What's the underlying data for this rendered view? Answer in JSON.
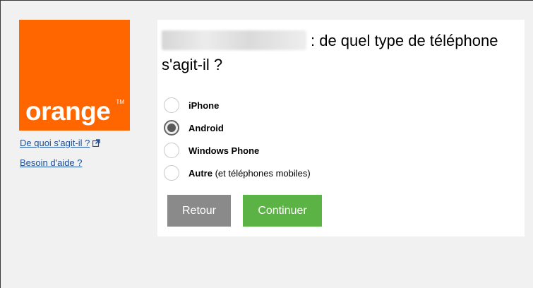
{
  "logo": {
    "text": "orange",
    "trademark": "TM"
  },
  "sidebar": {
    "what_is_it_label": "De quoi s'agit-il ?",
    "help_label": "Besoin d'aide ?"
  },
  "question": {
    "phone_number": "+33 6 77 80 22 75",
    "text_line": ": de quel type de téléphone s'agit-il ?"
  },
  "options": [
    {
      "label": "iPhone",
      "extra": "",
      "selected": false
    },
    {
      "label": "Android",
      "extra": "",
      "selected": true
    },
    {
      "label": "Windows Phone",
      "extra": "",
      "selected": false
    },
    {
      "label": "Autre",
      "extra": " (et téléphones mobiles)",
      "selected": false
    }
  ],
  "buttons": {
    "back_label": "Retour",
    "continue_label": "Continuer"
  },
  "colors": {
    "brand": "#ff6600",
    "continue": "#5cb345",
    "back": "#8a8a8a",
    "link": "#1a4f9c"
  }
}
